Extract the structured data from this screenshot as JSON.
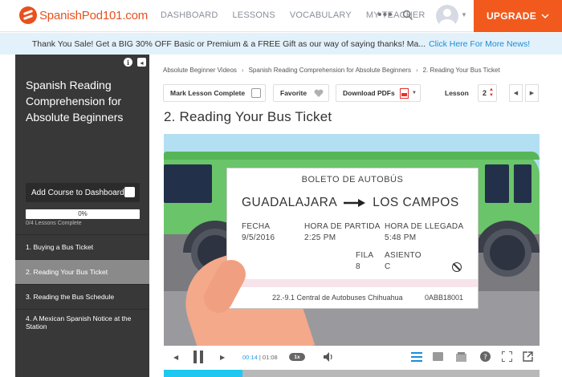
{
  "brand": {
    "name": "SpanishPod101.com",
    "accent": "#f25a1d",
    "link": "#1a8fd6"
  },
  "nav": {
    "links": [
      "DASHBOARD",
      "LESSONS",
      "VOCABULARY",
      "MY TEACHER"
    ],
    "more_icon": "more-dots-icon",
    "search_icon": "search-icon",
    "upgrade_label": "UPGRADE"
  },
  "promo": {
    "text": "Thank You Sale! Get a BIG 30% OFF Basic or Premium & a FREE Gift as our way of saying thanks! Ma...",
    "link": "Click Here For More News!"
  },
  "sidebar": {
    "title": "Spanish Reading Comprehension for Absolute Beginners",
    "add_label": "Add Course to Dashboard",
    "progress_percent": "0%",
    "progress_fraction": 0,
    "lessons_complete": "0/4 Lessons Complete",
    "items": [
      {
        "label": "1. Buying a Bus Ticket",
        "active": false
      },
      {
        "label": "2. Reading Your Bus Ticket",
        "active": true
      },
      {
        "label": "3. Reading the Bus Schedule",
        "active": false
      },
      {
        "label": "4. A Mexican Spanish Notice at the Station",
        "active": false
      }
    ]
  },
  "breadcrumb": [
    "Absolute Beginner Videos",
    "Spanish Reading Comprehension for Absolute Beginners",
    "2. Reading Your Bus Ticket"
  ],
  "toolbar": {
    "mark_complete": "Mark Lesson Complete",
    "favorite": "Favorite",
    "download": "Download PDFs",
    "lesson_label": "Lesson",
    "lesson_value": "2"
  },
  "lesson_title": "2. Reading Your Bus Ticket",
  "ticket": {
    "heading": "BOLETO DE AUTOBÚS",
    "from": "GUADALAJARA",
    "to": "LOS CAMPOS",
    "fecha_label": "FECHA",
    "fecha": "9/5/2016",
    "partida_label": "HORA DE PARTIDA",
    "partida": "2:25 PM",
    "llegada_label": "HORA DE LLEGADA",
    "llegada": "5:48 PM",
    "fila_label": "FILA",
    "fila": "8",
    "asiento_label": "ASIENTO",
    "asiento": "C",
    "address": "22.-9.1 Central de Autobuses Chihuahua",
    "code": "0ABB18001"
  },
  "player": {
    "current": "00:14",
    "duration": "01:08",
    "speed": "1x",
    "progress_fraction": 0.21
  }
}
